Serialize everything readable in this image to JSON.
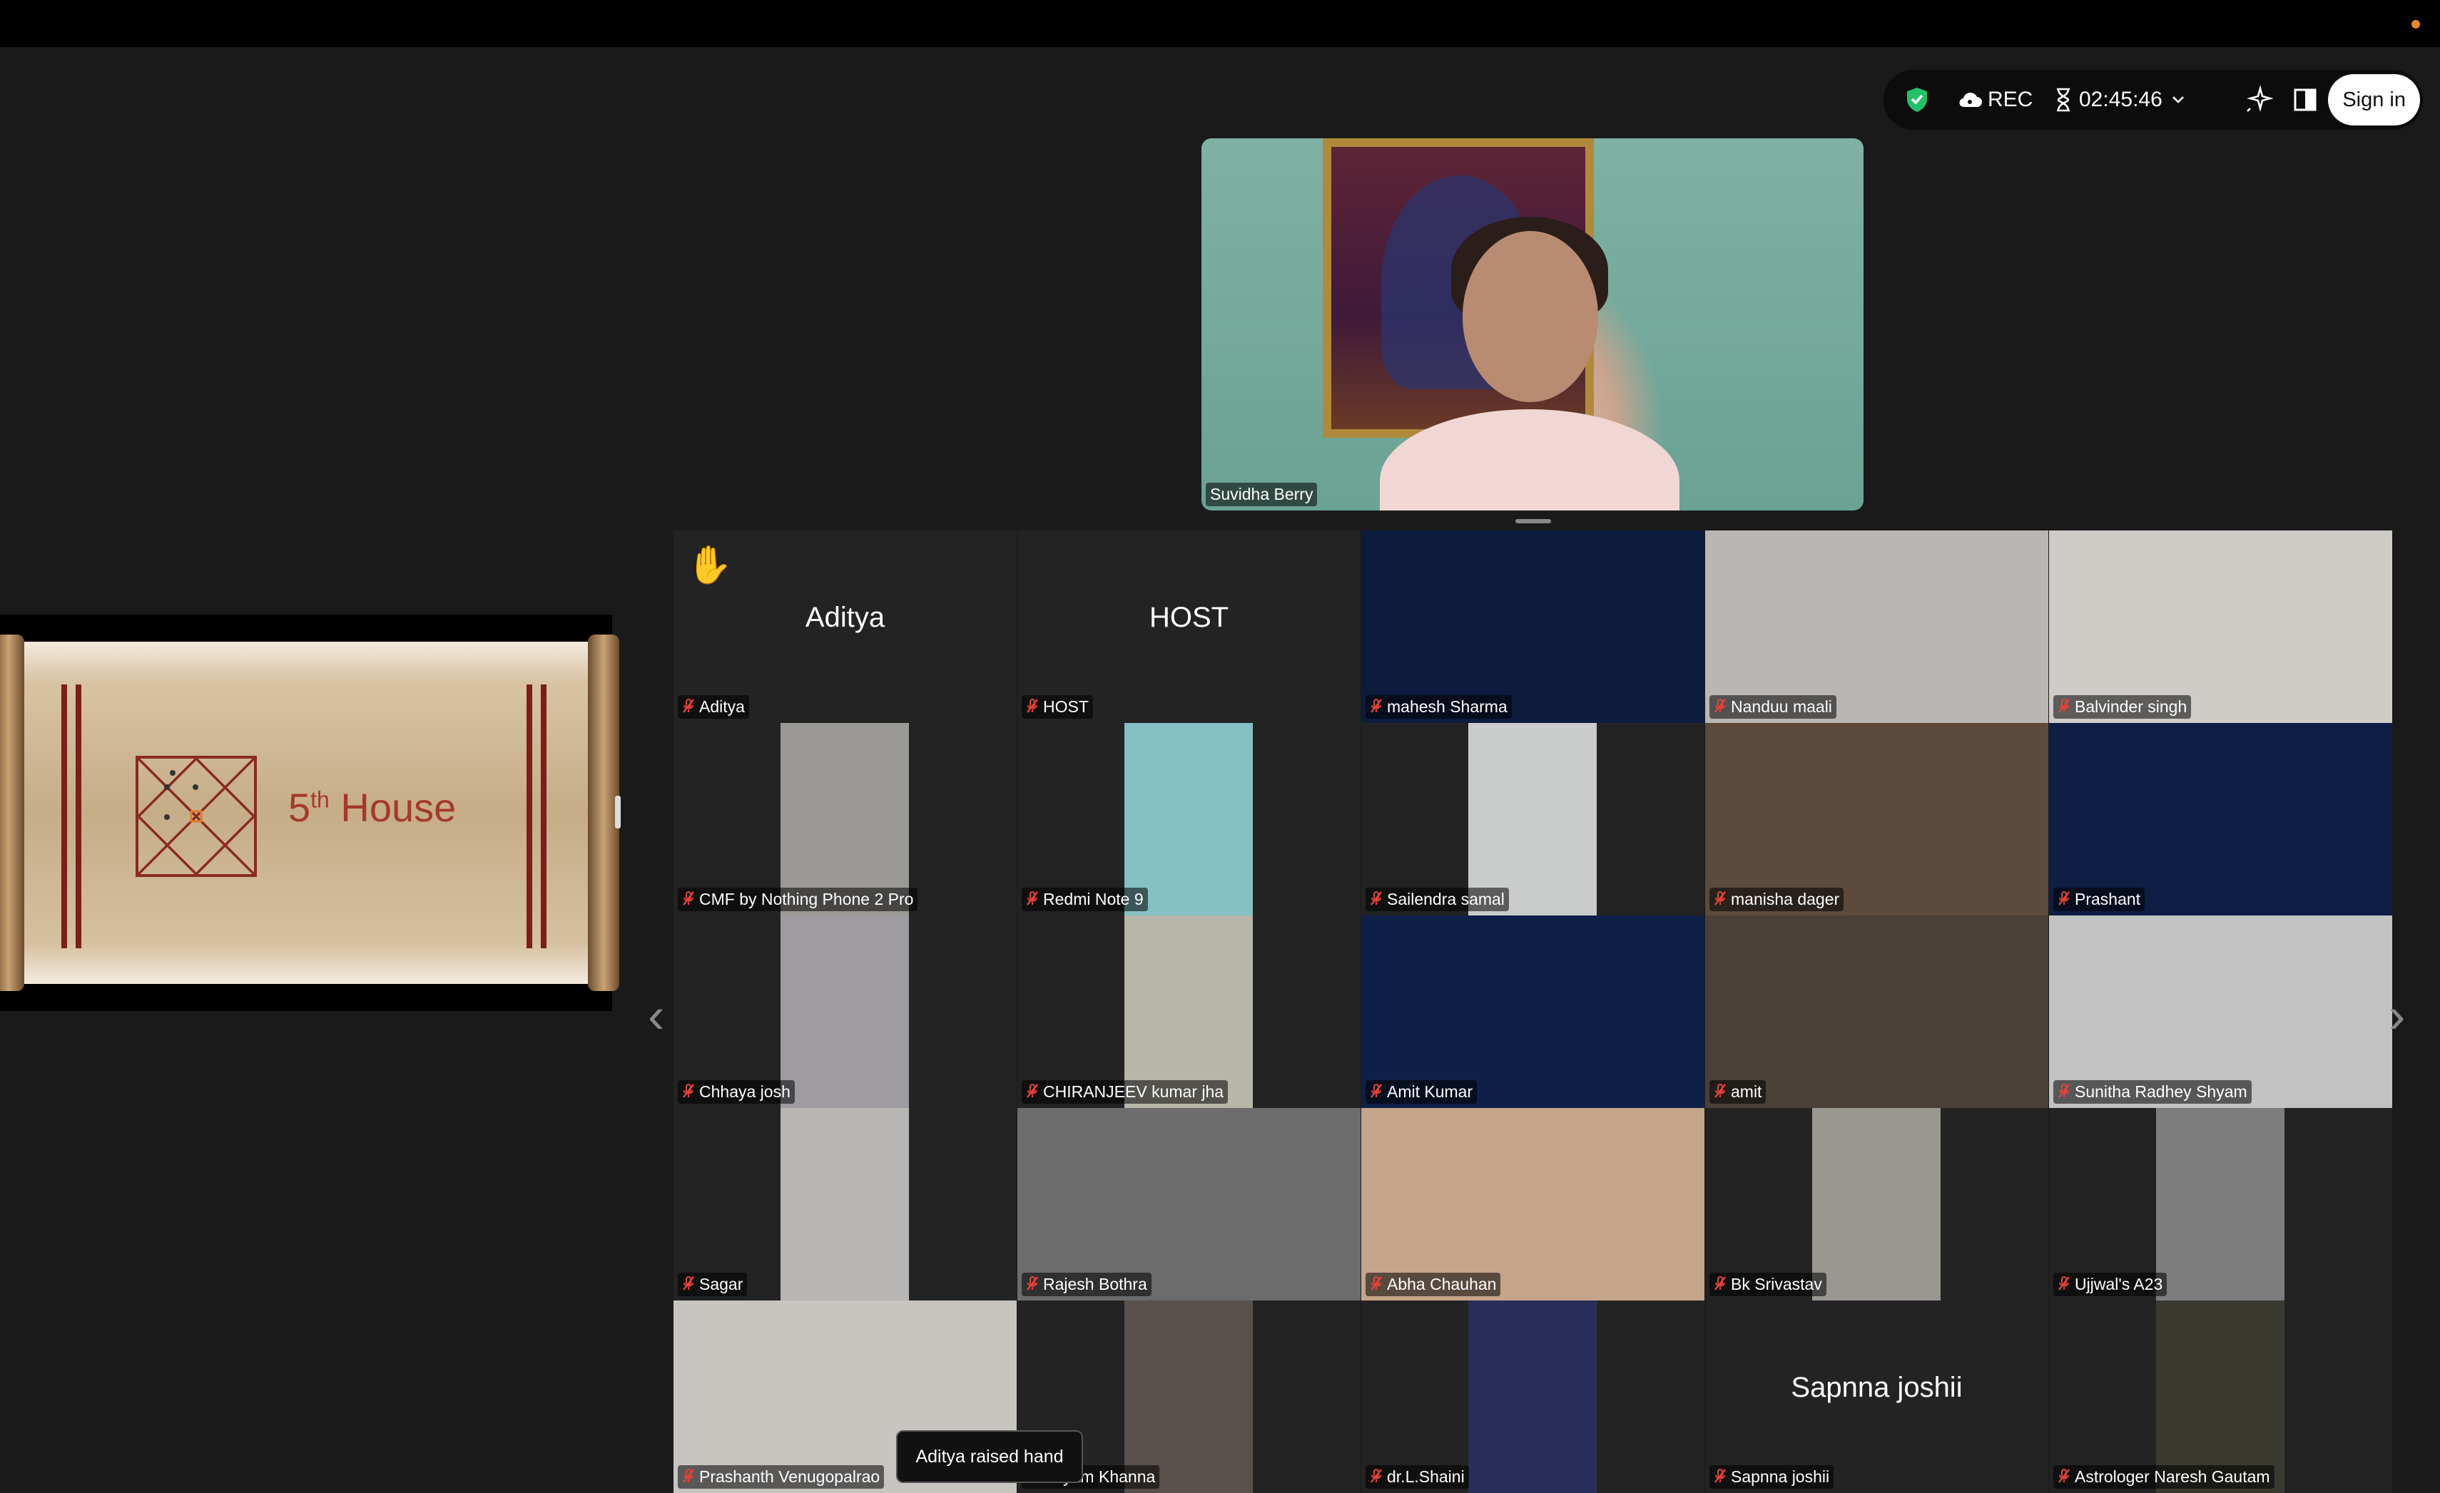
{
  "toolbar": {
    "rec_label": "REC",
    "timer": "02:45:46",
    "signin_label": "Sign in",
    "security_color": "#23c06a"
  },
  "speaker": {
    "name": "Suvidha Berry"
  },
  "share": {
    "title_num": "5",
    "title_sup": "th",
    "title_word": "House"
  },
  "tooltip": "Aditya raised hand",
  "tiles": [
    {
      "name": "Aditya",
      "big": "Aditya",
      "raised": true,
      "bg": "#232323"
    },
    {
      "name": "HOST",
      "big": "HOST",
      "bg": "#232323"
    },
    {
      "name": "mahesh Sharma",
      "bg": "#0d1c3c"
    },
    {
      "name": "Nanduu maali",
      "bg": "#b9b6b3"
    },
    {
      "name": "Balvinder singh",
      "bg": "#cfccc8"
    },
    {
      "name": "CMF by Nothing Phone 2 Pro",
      "bg": "#232323",
      "portrait": "#9b9995"
    },
    {
      "name": "Redmi Note 9",
      "bg": "#232323",
      "portrait": "#84c0c4"
    },
    {
      "name": "Sailendra samal",
      "bg": "#232323",
      "portrait": "#c9ccca"
    },
    {
      "name": "manisha dager",
      "bg": "#5c4a3c"
    },
    {
      "name": "Prashant",
      "bg": "#0e1e44"
    },
    {
      "name": "Chhaya josh",
      "bg": "#232323",
      "portrait": "#9e9ca0"
    },
    {
      "name": "CHIRANJEEV kumar jha",
      "bg": "#232323",
      "portrait": "#b8b6a8"
    },
    {
      "name": "Amit Kumar",
      "bg": "#0e2048"
    },
    {
      "name": "amit",
      "bg": "#4a4038"
    },
    {
      "name": "Sunitha Radhey Shyam",
      "bg": "#c3c2c2"
    },
    {
      "name": "Sagar",
      "bg": "#232323",
      "portrait": "#b7b6b4"
    },
    {
      "name": "Rajesh Bothra",
      "bg": "#6c6c6c"
    },
    {
      "name": "Abha Chauhan",
      "bg": "#c5a58a"
    },
    {
      "name": "Bk Srivastav",
      "bg": "#232323",
      "portrait": "#9a9690"
    },
    {
      "name": "Ujjwal's A23",
      "bg": "#232323",
      "portrait": "#7d7d7d"
    },
    {
      "name": "Prashanth Venugopalrao",
      "bg": "#c8c4bf"
    },
    {
      "name": "Shyam Khanna",
      "bg": "#232323",
      "portrait": "#58504a"
    },
    {
      "name": "dr.L.Shaini",
      "bg": "#232323",
      "portrait": "#2a2e5a"
    },
    {
      "name": "Sapnna joshii",
      "big": "Sapnna joshii",
      "bg": "#232323"
    },
    {
      "name": "Astrologer Naresh Gautam",
      "bg": "#232323",
      "portrait": "#3a3a30"
    }
  ]
}
